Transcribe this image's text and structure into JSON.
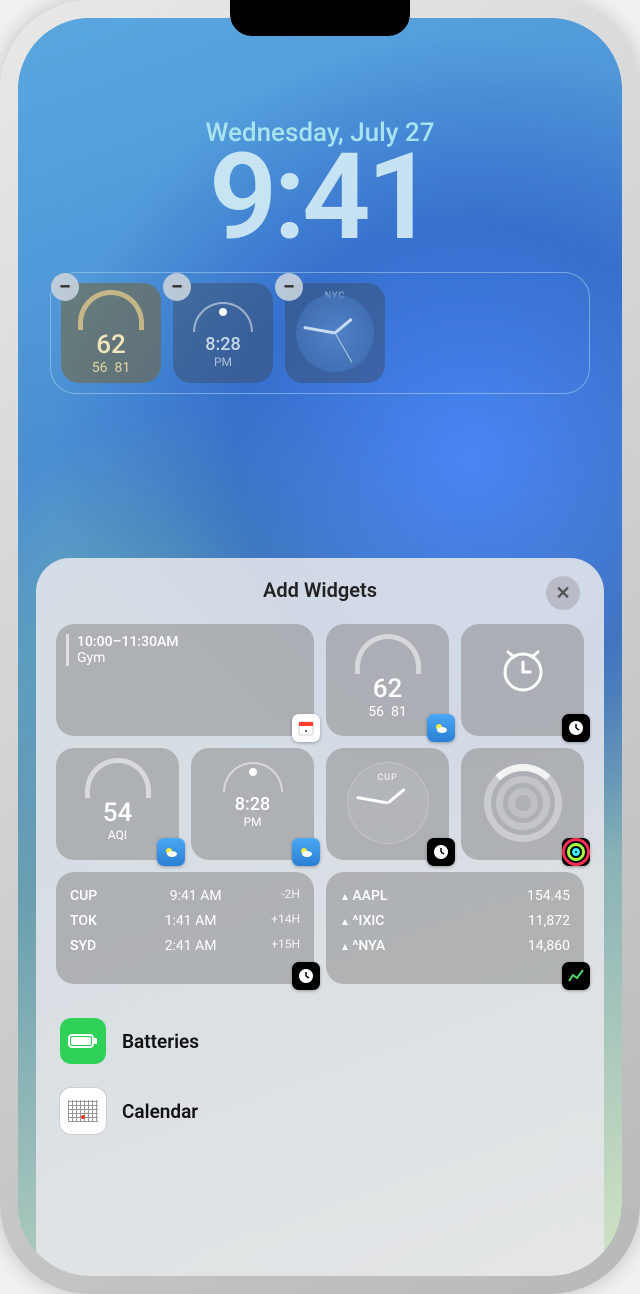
{
  "lockscreen": {
    "date": "Wednesday, July 27",
    "time": "9:41",
    "widgets": [
      {
        "type": "weather-gauge",
        "temp": "62",
        "low": "56",
        "high": "81"
      },
      {
        "type": "sunset",
        "time": "8:28",
        "period": "PM"
      },
      {
        "type": "world-clock",
        "city": "NYC"
      }
    ]
  },
  "sheet": {
    "title": "Add Widgets",
    "close_glyph": "✕",
    "suggested": {
      "calendar": {
        "time": "10:00–11:30AM",
        "title": "Gym"
      },
      "weather_gauge": {
        "temp": "62",
        "low": "56",
        "high": "81"
      },
      "alarm": {},
      "aqi": {
        "value": "54",
        "label": "AQI"
      },
      "sunset": {
        "time": "8:28",
        "period": "PM"
      },
      "analog_clock": {
        "city": "CUP"
      },
      "fitness": {},
      "world_clock": {
        "rows": [
          {
            "city": "CUP",
            "time": "9:41 AM",
            "offset": "-2H"
          },
          {
            "city": "TOK",
            "time": "1:41 AM",
            "offset": "+14H"
          },
          {
            "city": "SYD",
            "time": "2:41 AM",
            "offset": "+15H"
          }
        ]
      },
      "stocks": {
        "rows": [
          {
            "symbol": "AAPL",
            "price": "154.45"
          },
          {
            "symbol": "^IXIC",
            "price": "11,872"
          },
          {
            "symbol": "^NYA",
            "price": "14,860"
          }
        ]
      }
    },
    "apps": [
      {
        "name": "Batteries",
        "icon": "batteries"
      },
      {
        "name": "Calendar",
        "icon": "calendar"
      }
    ]
  }
}
